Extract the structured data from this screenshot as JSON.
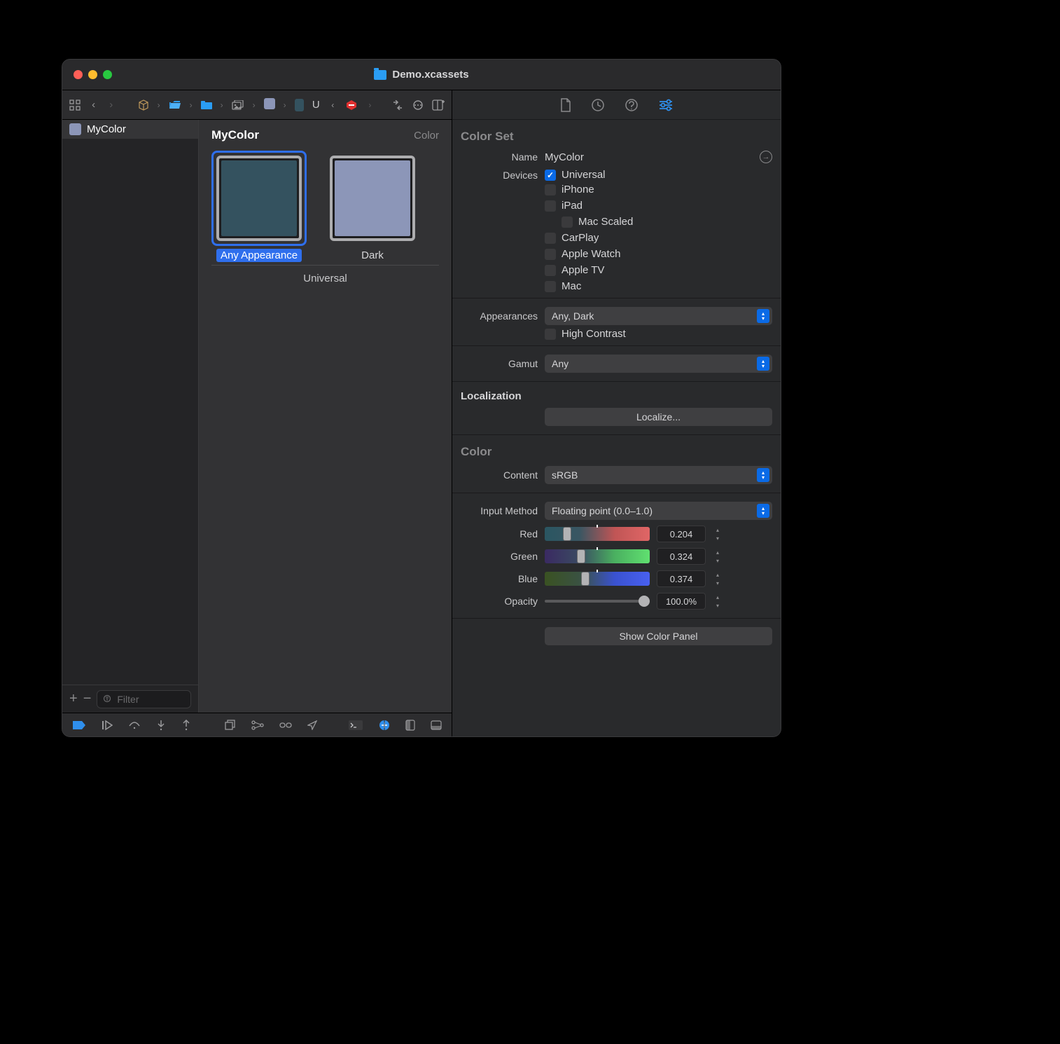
{
  "window": {
    "title": "Demo.xcassets"
  },
  "asset_list": {
    "items": [
      {
        "name": "MyColor",
        "swatch": "#8c96b8"
      }
    ],
    "filter_placeholder": "Filter"
  },
  "detail": {
    "title": "MyColor",
    "type": "Color",
    "group_label": "Universal",
    "wells": [
      {
        "label": "Any Appearance",
        "color": "#34525f",
        "selected": true
      },
      {
        "label": "Dark",
        "color": "#8c96b8",
        "selected": false
      }
    ]
  },
  "inspector": {
    "section_colorset": "Color Set",
    "name_label": "Name",
    "name_value": "MyColor",
    "devices_label": "Devices",
    "devices": [
      {
        "label": "Universal",
        "checked": true
      },
      {
        "label": "iPhone",
        "checked": false
      },
      {
        "label": "iPad",
        "checked": false
      },
      {
        "label": "Mac Scaled",
        "checked": false,
        "indent": true
      },
      {
        "label": "CarPlay",
        "checked": false
      },
      {
        "label": "Apple Watch",
        "checked": false
      },
      {
        "label": "Apple TV",
        "checked": false
      },
      {
        "label": "Mac",
        "checked": false
      }
    ],
    "appearances_label": "Appearances",
    "appearances_value": "Any, Dark",
    "high_contrast_label": "High Contrast",
    "gamut_label": "Gamut",
    "gamut_value": "Any",
    "localization_label": "Localization",
    "localize_button": "Localize...",
    "section_color": "Color",
    "content_label": "Content",
    "content_value": "sRGB",
    "input_method_label": "Input Method",
    "input_method_value": "Floating point (0.0–1.0)",
    "channels": {
      "red": {
        "label": "Red",
        "value": "0.204",
        "pos": 20
      },
      "green": {
        "label": "Green",
        "value": "0.324",
        "pos": 32
      },
      "blue": {
        "label": "Blue",
        "value": "0.374",
        "pos": 37
      }
    },
    "opacity_label": "Opacity",
    "opacity_value": "100.0%",
    "show_panel": "Show Color Panel"
  }
}
